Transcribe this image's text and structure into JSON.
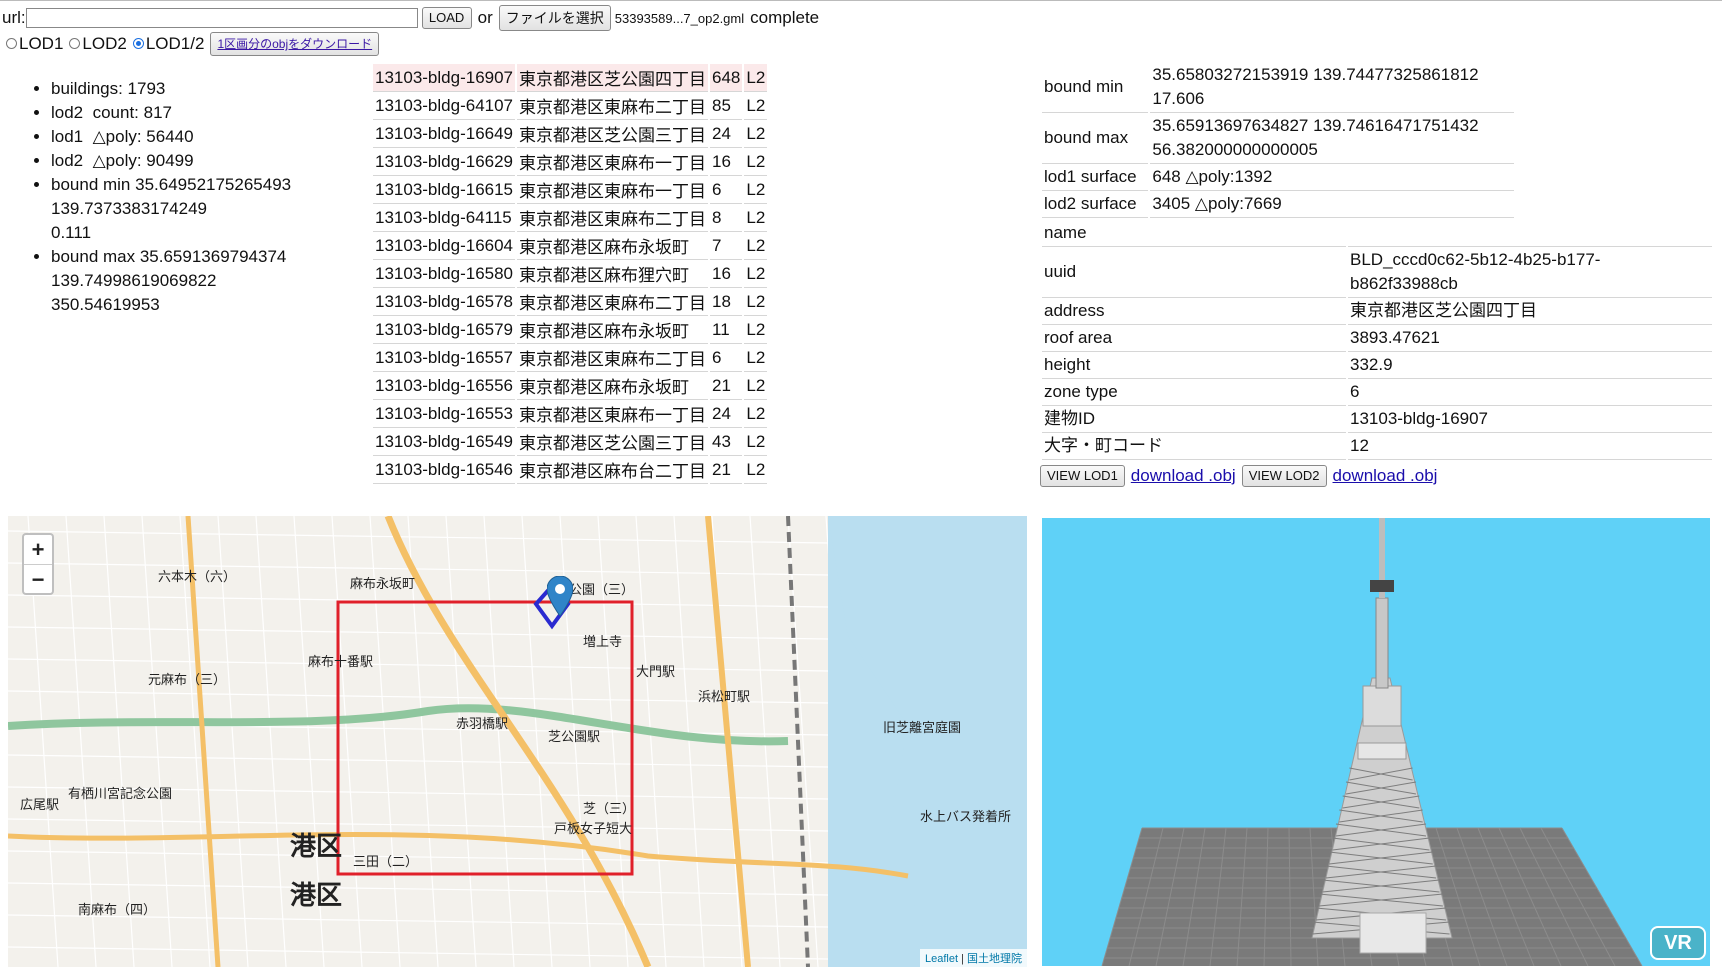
{
  "toolbar": {
    "url_label": "url:",
    "url_value": "",
    "load_label": "LOAD",
    "or_label": "or",
    "file_button_label": "ファイルを選択",
    "file_name": "53393589...7_op2.gml",
    "status": "complete"
  },
  "lod_options": [
    {
      "label": "LOD1",
      "selected": false
    },
    {
      "label": "LOD2",
      "selected": false
    },
    {
      "label": "LOD1/2",
      "selected": true
    }
  ],
  "download_ward_label": "1区画分のobjをダウンロード",
  "stats": [
    "buildings: 1793",
    "lod2  count: 817",
    "lod1  △poly: 56440",
    "lod2  △poly: 90499",
    "bound min 35.64952175265493\n139.7373383174249\n0.111",
    "bound max 35.6591369794374\n139.74998619069822\n350.54619953"
  ],
  "buildings": [
    {
      "id": "13103-bldg-16907",
      "address": "東京都港区芝公園四丁目",
      "count": "648",
      "lod": "L2"
    },
    {
      "id": "13103-bldg-64107",
      "address": "東京都港区東麻布二丁目",
      "count": "85",
      "lod": "L2"
    },
    {
      "id": "13103-bldg-16649",
      "address": "東京都港区芝公園三丁目",
      "count": "24",
      "lod": "L2"
    },
    {
      "id": "13103-bldg-16629",
      "address": "東京都港区東麻布一丁目",
      "count": "16",
      "lod": "L2"
    },
    {
      "id": "13103-bldg-16615",
      "address": "東京都港区東麻布一丁目",
      "count": "6",
      "lod": "L2"
    },
    {
      "id": "13103-bldg-64115",
      "address": "東京都港区東麻布二丁目",
      "count": "8",
      "lod": "L2"
    },
    {
      "id": "13103-bldg-16604",
      "address": "東京都港区麻布永坂町",
      "count": "7",
      "lod": "L2"
    },
    {
      "id": "13103-bldg-16580",
      "address": "東京都港区麻布狸穴町",
      "count": "16",
      "lod": "L2"
    },
    {
      "id": "13103-bldg-16578",
      "address": "東京都港区東麻布二丁目",
      "count": "18",
      "lod": "L2"
    },
    {
      "id": "13103-bldg-16579",
      "address": "東京都港区麻布永坂町",
      "count": "11",
      "lod": "L2"
    },
    {
      "id": "13103-bldg-16557",
      "address": "東京都港区東麻布二丁目",
      "count": "6",
      "lod": "L2"
    },
    {
      "id": "13103-bldg-16556",
      "address": "東京都港区麻布永坂町",
      "count": "21",
      "lod": "L2"
    },
    {
      "id": "13103-bldg-16553",
      "address": "東京都港区東麻布一丁目",
      "count": "24",
      "lod": "L2"
    },
    {
      "id": "13103-bldg-16549",
      "address": "東京都港区芝公園三丁目",
      "count": "43",
      "lod": "L2"
    },
    {
      "id": "13103-bldg-16546",
      "address": "東京都港区麻布台二丁目",
      "count": "21",
      "lod": "L2"
    }
  ],
  "summary": [
    {
      "label": "bound min",
      "value": "35.65803272153919 139.74477325861812\n17.606"
    },
    {
      "label": "bound max",
      "value": "35.65913697634827 139.74616471751432\n56.382000000000005"
    },
    {
      "label": "lod1 surface",
      "value": "648 △poly:1392"
    },
    {
      "label": "lod2 surface",
      "value": "3405 △poly:7669"
    }
  ],
  "attributes": [
    {
      "label": "name",
      "value": ""
    },
    {
      "label": "uuid",
      "value": "BLD_cccd0c62-5b12-4b25-b177-\nb862f33988cb"
    },
    {
      "label": "address",
      "value": "東京都港区芝公園四丁目"
    },
    {
      "label": "roof area",
      "value": "3893.47621"
    },
    {
      "label": "height",
      "value": "332.9"
    },
    {
      "label": "zone type",
      "value": "6"
    },
    {
      "label": "建物ID",
      "value": "13103-bldg-16907"
    },
    {
      "label": "大字・町コード",
      "value": "12"
    }
  ],
  "actions": {
    "view_lod1": "VIEW LOD1",
    "download1": "download .obj",
    "view_lod2": "VIEW LOD2",
    "download2": "download .obj"
  },
  "map": {
    "zoom_in": "+",
    "zoom_out": "−",
    "attribution_leaflet": "Leaflet",
    "attribution_sep": " | ",
    "attribution_gsi": "国土地理院",
    "labels": [
      {
        "text": "麻布永坂町"
      },
      {
        "text": "芝公園（三）"
      },
      {
        "text": "麻布十番駅"
      },
      {
        "text": "赤羽橋駅"
      },
      {
        "text": "芝公園駅"
      },
      {
        "text": "大門駅"
      },
      {
        "text": "浜松町駅"
      },
      {
        "text": "三田（二）"
      },
      {
        "text": "元麻布（三）"
      },
      {
        "text": "南麻布（四）"
      },
      {
        "text": "有栖川宮記念公園"
      },
      {
        "text": "広尾駅"
      },
      {
        "text": "六本木（六）"
      },
      {
        "text": "増上寺"
      },
      {
        "text": "芝（三）"
      },
      {
        "text": "戸板女子短大"
      },
      {
        "text": "水上バス発着所"
      },
      {
        "text": "旧芝離宮庭園"
      },
      {
        "text": "港区"
      },
      {
        "text": "港区"
      }
    ]
  },
  "vr_label": "VR",
  "colors": {
    "selection_row": "#fbe9ea",
    "map_selection_box": "#e0202a",
    "viewer_sky": "#5fd1f7",
    "link": "#1a0dab"
  }
}
